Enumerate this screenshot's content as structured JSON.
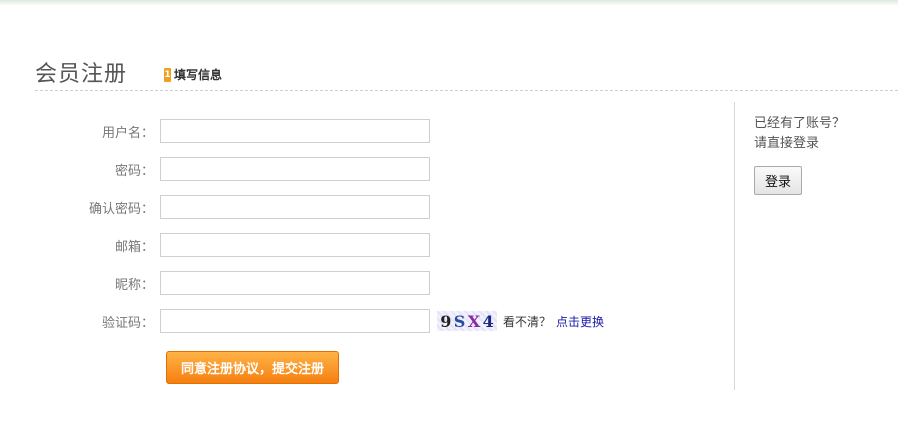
{
  "header": {
    "title": "会员注册",
    "step_number": "1",
    "step_label": "填写信息"
  },
  "form": {
    "fields": [
      {
        "label": "用户名：",
        "value": "",
        "placeholder": ""
      },
      {
        "label": "密码：",
        "value": "",
        "placeholder": ""
      },
      {
        "label": "确认密码：",
        "value": "",
        "placeholder": ""
      },
      {
        "label": "邮箱：",
        "value": "",
        "placeholder": ""
      },
      {
        "label": "昵称：",
        "value": "",
        "placeholder": ""
      },
      {
        "label": "验证码：",
        "value": "",
        "placeholder": ""
      }
    ],
    "captcha": {
      "chars": [
        "9",
        "S",
        "X",
        "4"
      ],
      "hint": "看不清？",
      "refresh_label": "点击更换"
    },
    "submit_label": "同意注册协议，提交注册"
  },
  "side": {
    "line1": "已经有了账号？",
    "line2": "请直接登录",
    "login_label": "登录"
  },
  "colors": {
    "accent": "#f57f10",
    "link": "#1a1aa8"
  }
}
